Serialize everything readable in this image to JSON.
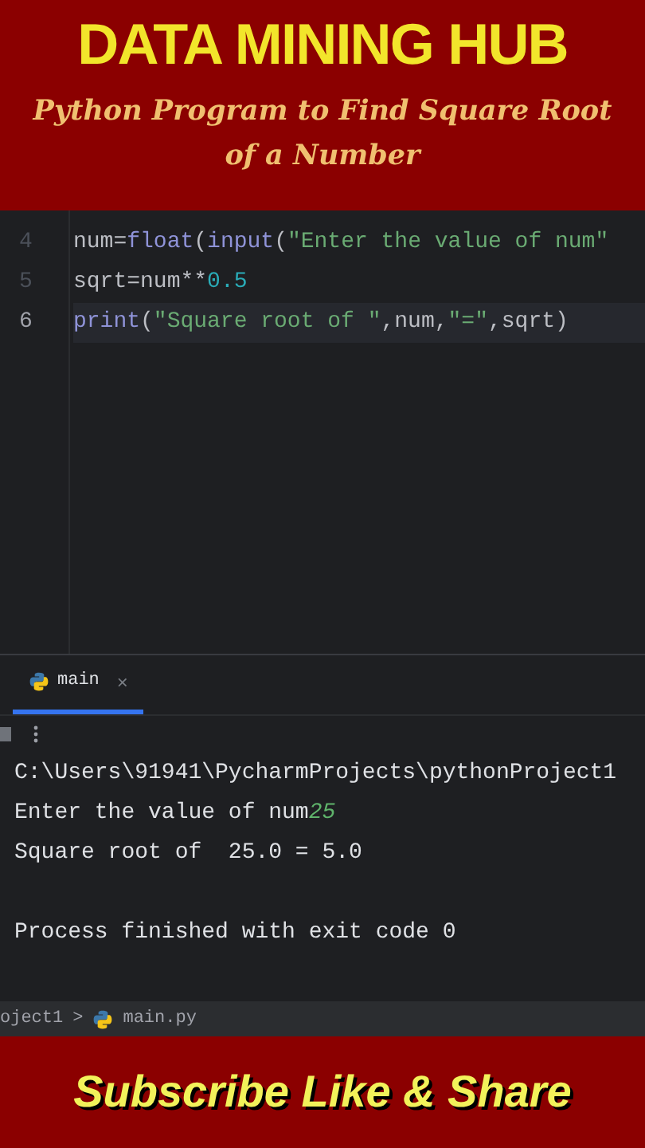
{
  "banner": {
    "title": "DATA MINING HUB",
    "subtitle": "Python Program to Find Square Root of a Number"
  },
  "editor": {
    "lines": [
      {
        "number": "4",
        "current": false,
        "tokens": [
          {
            "kind": "ident",
            "text": "num"
          },
          {
            "kind": "op",
            "text": "="
          },
          {
            "kind": "builtin",
            "text": "float"
          },
          {
            "kind": "op",
            "text": "("
          },
          {
            "kind": "builtin",
            "text": "input"
          },
          {
            "kind": "op",
            "text": "("
          },
          {
            "kind": "string",
            "text": "\"Enter the value of num\""
          }
        ]
      },
      {
        "number": "5",
        "current": false,
        "tokens": [
          {
            "kind": "ident",
            "text": "sqrt"
          },
          {
            "kind": "op",
            "text": "="
          },
          {
            "kind": "ident",
            "text": "num"
          },
          {
            "kind": "op",
            "text": "**"
          },
          {
            "kind": "number",
            "text": "0.5"
          }
        ]
      },
      {
        "number": "6",
        "current": true,
        "tokens": [
          {
            "kind": "builtin",
            "text": "print"
          },
          {
            "kind": "op",
            "text": "("
          },
          {
            "kind": "string",
            "text": "\"Square root of \""
          },
          {
            "kind": "op",
            "text": ","
          },
          {
            "kind": "ident",
            "text": "num"
          },
          {
            "kind": "op",
            "text": ","
          },
          {
            "kind": "string",
            "text": "\"=\""
          },
          {
            "kind": "op",
            "text": ","
          },
          {
            "kind": "ident",
            "text": "sqrt"
          },
          {
            "kind": "op",
            "text": ")"
          }
        ]
      }
    ]
  },
  "run_panel": {
    "tabs": [
      {
        "label": "main",
        "selected": true,
        "close": "×"
      }
    ],
    "output": [
      {
        "parts": [
          {
            "kind": "out",
            "text": "C:\\Users\\91941\\PycharmProjects\\pythonProject1"
          }
        ]
      },
      {
        "parts": [
          {
            "kind": "out",
            "text": "Enter the value of num"
          },
          {
            "kind": "input",
            "text": "25"
          }
        ]
      },
      {
        "parts": [
          {
            "kind": "out",
            "text": "Square root of  25.0 = 5.0"
          }
        ]
      },
      {
        "kind": "blank"
      },
      {
        "parts": [
          {
            "kind": "out",
            "text": "Process finished with exit code 0"
          }
        ]
      }
    ]
  },
  "breadcrumb": {
    "items": [
      "oject1",
      "main.py"
    ],
    "separator": ">"
  },
  "footer": {
    "text": "Subscribe Like & Share"
  }
}
